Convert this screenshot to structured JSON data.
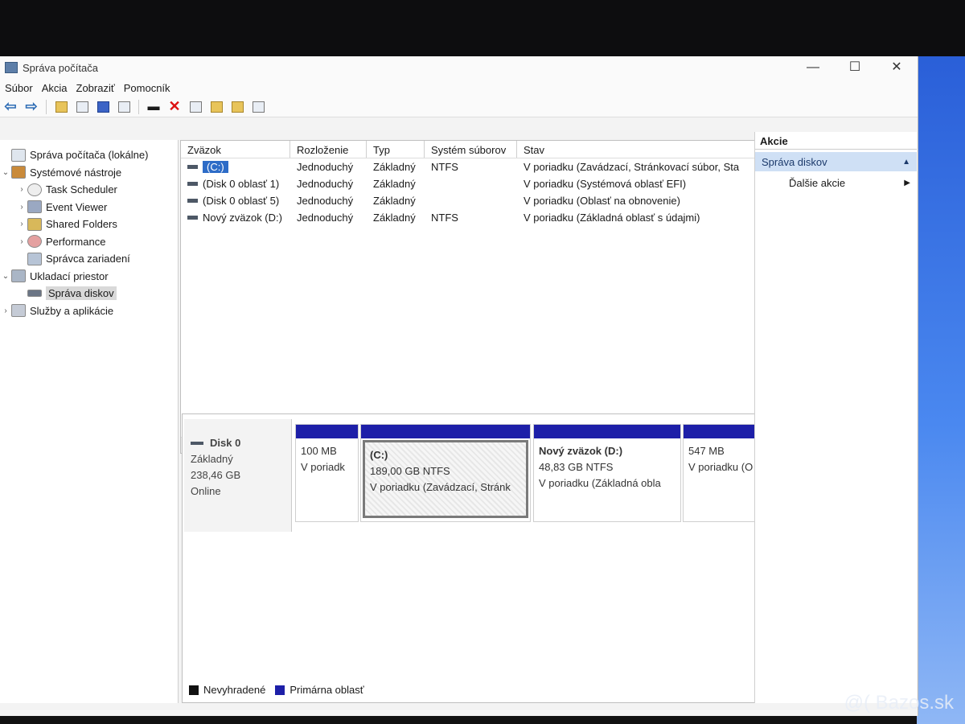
{
  "window": {
    "title": "Správa počítača",
    "min_glyph": "—",
    "max_glyph": "☐",
    "close_glyph": "✕"
  },
  "menu": [
    "Súbor",
    "Akcia",
    "Zobraziť",
    "Pomocník"
  ],
  "toolbar_icons": [
    "back-arrow",
    "forward-arrow",
    "folder-up",
    "console-tree",
    "help",
    "properties",
    "disk",
    "delete",
    "refresh",
    "up-folder",
    "search-folder",
    "export"
  ],
  "tree": {
    "items": [
      {
        "label": "Správa počítača (lokálne)",
        "arrow": "",
        "icon": "computer-management-icon"
      },
      {
        "label": "Systémové nástroje",
        "arrow": "⌄",
        "icon": "system-tools-icon"
      },
      {
        "label": "Task Scheduler",
        "arrow": "›",
        "icon": "task-scheduler-icon"
      },
      {
        "label": "Event Viewer",
        "arrow": "›",
        "icon": "event-viewer-icon"
      },
      {
        "label": "Shared Folders",
        "arrow": "›",
        "icon": "shared-folders-icon"
      },
      {
        "label": "Performance",
        "arrow": "›",
        "icon": "performance-icon"
      },
      {
        "label": "Správca zariadení",
        "arrow": "",
        "icon": "device-manager-icon"
      },
      {
        "label": "Ukladací priestor",
        "arrow": "⌄",
        "icon": "storage-icon"
      },
      {
        "label": "Správa diskov",
        "arrow": "",
        "icon": "disk-management-icon"
      },
      {
        "label": "Služby a aplikácie",
        "arrow": "›",
        "icon": "services-icon"
      }
    ]
  },
  "volumes": {
    "headers": [
      "Zväzok",
      "Rozloženie",
      "Typ",
      "Systém súborov",
      "Stav"
    ],
    "rows": [
      [
        "(C:)",
        "Jednoduchý",
        "Základný",
        "NTFS",
        "V poriadku (Zavádzací, Stránkovací súbor, Sta"
      ],
      [
        "(Disk 0 oblasť 1)",
        "Jednoduchý",
        "Základný",
        "",
        "V poriadku (Systémová oblasť EFI)"
      ],
      [
        "(Disk 0 oblasť 5)",
        "Jednoduchý",
        "Základný",
        "",
        "V poriadku (Oblasť na obnovenie)"
      ],
      [
        "Nový zväzok (D:)",
        "Jednoduchý",
        "Základný",
        "NTFS",
        "V poriadku (Základná oblasť s údajmi)"
      ]
    ],
    "scroll_left": "‹",
    "scroll_right": "›"
  },
  "disk": {
    "name": "Disk 0",
    "type": "Základný",
    "size": "238,46 GB",
    "status": "Online",
    "partitions": [
      {
        "name": "",
        "size": "100 MB",
        "status": "V poriadk"
      },
      {
        "name": "(C:)",
        "size": "189,00 GB NTFS",
        "status": "V poriadku (Zavádzací, Stránk"
      },
      {
        "name": "Nový zväzok  (D:)",
        "size": "48,83 GB NTFS",
        "status": "V poriadku (Základná obla"
      },
      {
        "name": "",
        "size": "547 MB",
        "status": "V poriadku (O"
      }
    ]
  },
  "legend": [
    {
      "label": "Nevyhradené",
      "color": "#111111"
    },
    {
      "label": "Primárna oblasť",
      "color": "#1d1fa8"
    }
  ],
  "actions": {
    "title": "Akcie",
    "section": "Správa diskov",
    "section_caret": "▲",
    "items": [
      {
        "label": "Ďalšie akcie",
        "arrow": "▶"
      }
    ]
  },
  "watermark": "@( Bazos.sk"
}
